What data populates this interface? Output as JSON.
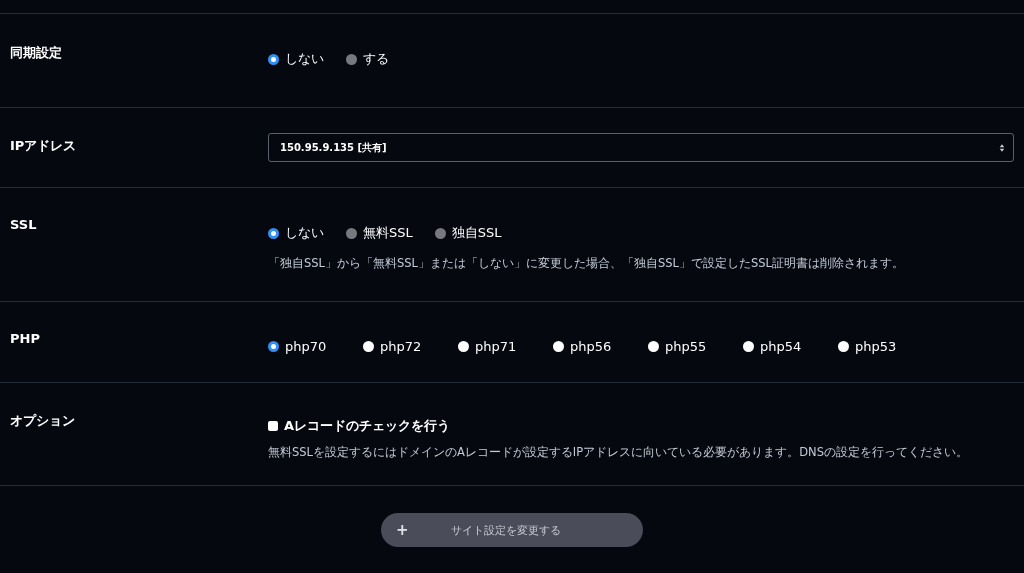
{
  "rows": [
    {
      "label": "同期設定",
      "kind": "radio",
      "options": [
        {
          "label": "しない",
          "selected": true
        },
        {
          "label": "する",
          "selected": false
        }
      ]
    },
    {
      "label": "IPアドレス",
      "kind": "select",
      "value": "150.95.9.135 [共有]"
    },
    {
      "label": "SSL",
      "kind": "radio",
      "options": [
        {
          "label": "しない",
          "selected": true
        },
        {
          "label": "無料SSL",
          "selected": false
        },
        {
          "label": "独自SSL",
          "selected": false
        }
      ],
      "note": "「独自SSL」から「無料SSL」または「しない」に変更した場合、「独自SSL」で設定したSSL証明書は削除されます。"
    },
    {
      "label": "PHP",
      "kind": "version-radio",
      "options": [
        {
          "label": "php70",
          "selected": true
        },
        {
          "label": "php72",
          "selected": false
        },
        {
          "label": "php71",
          "selected": false
        },
        {
          "label": "php56",
          "selected": false
        },
        {
          "label": "php55",
          "selected": false
        },
        {
          "label": "php54",
          "selected": false
        },
        {
          "label": "php53",
          "selected": false
        }
      ]
    },
    {
      "label": "オプション",
      "kind": "checkbox",
      "option": {
        "label": "Aレコードのチェックを行う",
        "checked": false
      },
      "note": "無料SSLを設定するにはドメインのAレコードが設定するIPアドレスに向いている必要があります。DNSの設定を行ってください。"
    }
  ],
  "submit": {
    "icon": "+",
    "label": "サイト設定を変更する"
  }
}
